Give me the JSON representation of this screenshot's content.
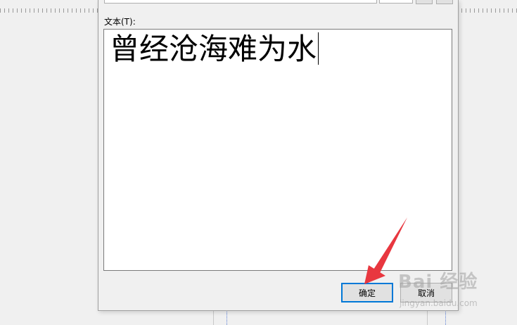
{
  "dialog": {
    "text_label": "文本(T):",
    "text_value": "曾经沧海难为水",
    "ok_label": "确定",
    "cancel_label": "取消"
  },
  "watermark": {
    "logo_text": "Bai 经验",
    "url": "jingyan.baidu.com"
  },
  "colors": {
    "arrow": "#e8373f",
    "focus_border": "#0078d7"
  }
}
